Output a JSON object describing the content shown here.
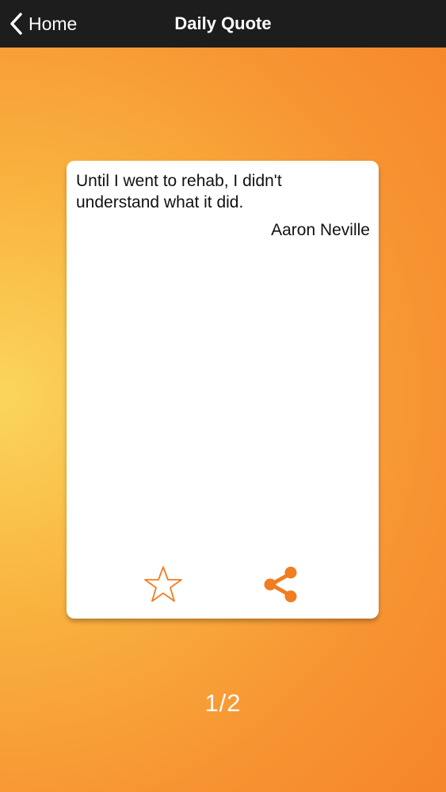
{
  "navbar": {
    "back_label": "Home",
    "title": "Daily Quote",
    "back_icon": "chevron-left-icon"
  },
  "quote": {
    "text": "Until I went to rehab, I didn't understand what it did.",
    "author": "Aaron Neville"
  },
  "actions": {
    "favorite_icon": "star-outline-icon",
    "share_icon": "share-icon"
  },
  "pager": {
    "current": 1,
    "total": 2,
    "label": "1/2"
  },
  "colors": {
    "navbar": "#1d1d1d",
    "accent": "#f07d22",
    "background_light": "#fbd65b",
    "background_dark": "#f47b24"
  }
}
